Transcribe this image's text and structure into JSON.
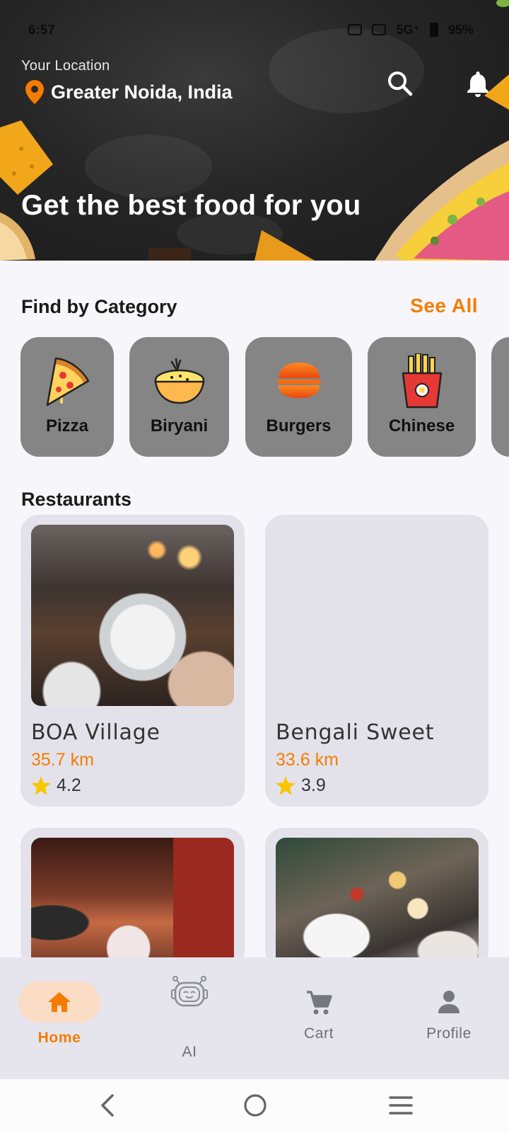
{
  "status_bar": {
    "time": "6:57",
    "network": "5G⁺",
    "battery": "95%"
  },
  "header": {
    "location_label": "Your Location",
    "location": "Greater Noida, India",
    "headline": "Get the best food for you"
  },
  "category_section": {
    "title": "Find by Category",
    "see_all": "See All",
    "items": [
      {
        "label": "Pizza",
        "icon": "pizza-icon"
      },
      {
        "label": "Biryani",
        "icon": "biryani-icon"
      },
      {
        "label": "Burgers",
        "icon": "burger-icon"
      },
      {
        "label": "Chinese",
        "icon": "fries-icon"
      }
    ]
  },
  "restaurants_section": {
    "title": "Restaurants",
    "items": [
      {
        "name": "BOA Village",
        "distance": "35.7 km",
        "rating": "4.2"
      },
      {
        "name": "Bengali Sweet",
        "distance": "33.6 km",
        "rating": "3.9"
      }
    ]
  },
  "bottom_nav": {
    "items": [
      {
        "label": "Home",
        "icon": "home-icon",
        "active": true
      },
      {
        "label": "AI",
        "icon": "robot-icon",
        "active": false
      },
      {
        "label": "Cart",
        "icon": "cart-icon",
        "active": false
      },
      {
        "label": "Profile",
        "icon": "person-icon",
        "active": false
      }
    ]
  },
  "colors": {
    "accent": "#f57c00",
    "category_bg": "#858585",
    "card_bg": "#e3e2ea",
    "nav_active_pill": "#fbdcc4"
  }
}
